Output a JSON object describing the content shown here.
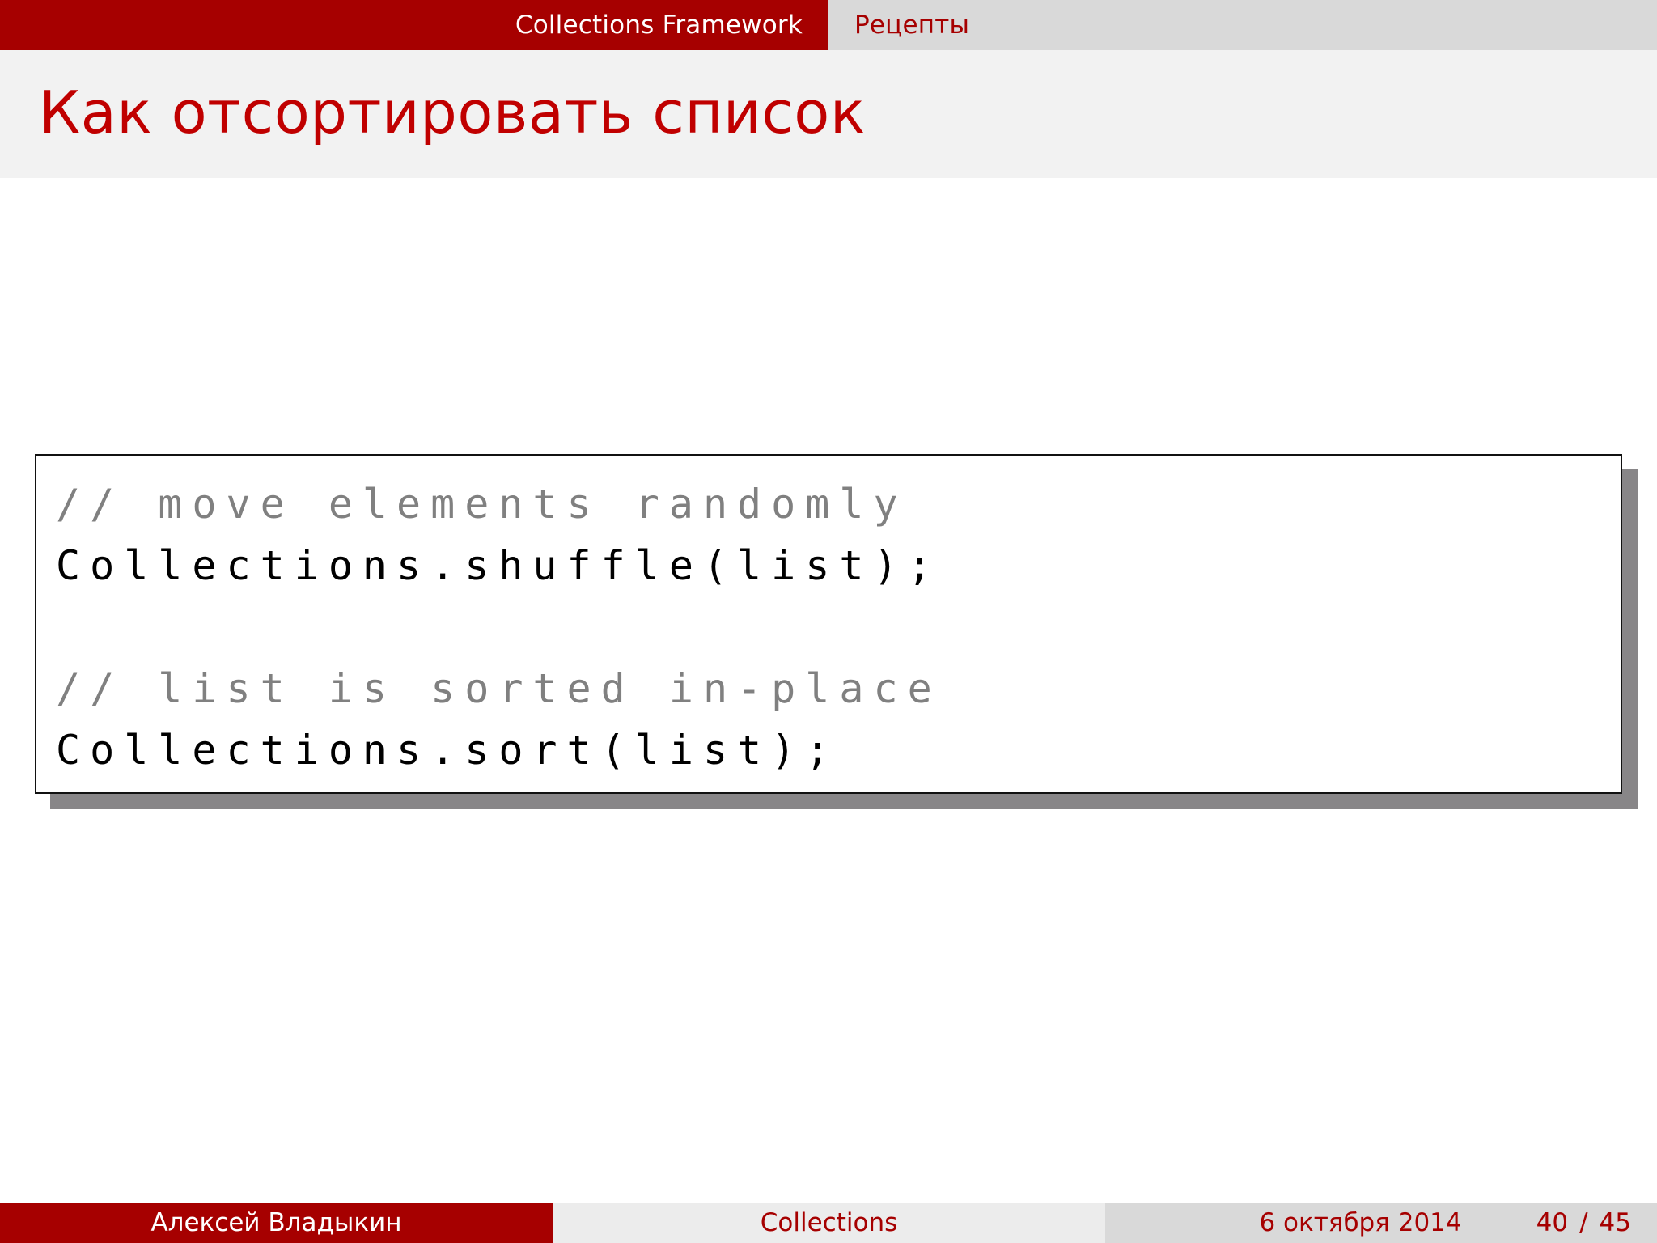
{
  "header": {
    "section": "Collections Framework",
    "subsection": "Рецепты"
  },
  "frame": {
    "title": "Как отсортировать список"
  },
  "code": {
    "lines": [
      {
        "kind": "comment",
        "text": "// move elements randomly"
      },
      {
        "kind": "statement",
        "text": "Collections.shuffle(list);"
      },
      {
        "kind": "blank",
        "text": ""
      },
      {
        "kind": "comment",
        "text": "// list is sorted in-place"
      },
      {
        "kind": "statement",
        "text": "Collections.sort(list);"
      }
    ]
  },
  "footer": {
    "author": "Алексей Владыкин",
    "short_title": "Collections",
    "date": "6 октября 2014",
    "page_current": "40",
    "page_separator": "/",
    "page_total": "45"
  },
  "colors": {
    "accent": "#a60000",
    "title": "#c00000",
    "comment": "#808080",
    "shadow": "#888688"
  }
}
